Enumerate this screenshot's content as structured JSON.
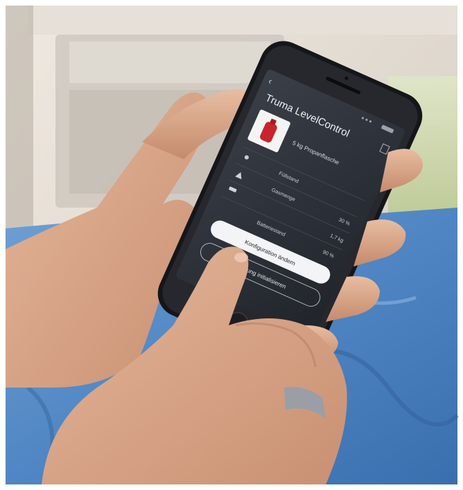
{
  "scene": {
    "description_colors": {
      "background_light": "#e9e3da",
      "fabric_blue": "#4f86c3",
      "skin": "#d9a98a",
      "phone_body": "#1a1b1f",
      "screen_bg": "#2c3038",
      "accent_red": "#c8242d"
    }
  },
  "app": {
    "back_glyph": "‹",
    "title": "Truma LevelControl",
    "product_name": "5 kg Propanflasche",
    "rows": [
      {
        "icon": "wifi-icon",
        "label": "Füllstand",
        "value": ""
      },
      {
        "icon": "warning-icon",
        "label": "Gasmenge",
        "value": "30 %"
      },
      {
        "icon": "battery-icon",
        "label": "",
        "value": "1,7 kg"
      },
      {
        "icon": "",
        "label": "Batteriestand",
        "value": "90 %"
      }
    ],
    "primary_button": "Konfiguration ändern",
    "secondary_button": "Messung initialisieren"
  }
}
